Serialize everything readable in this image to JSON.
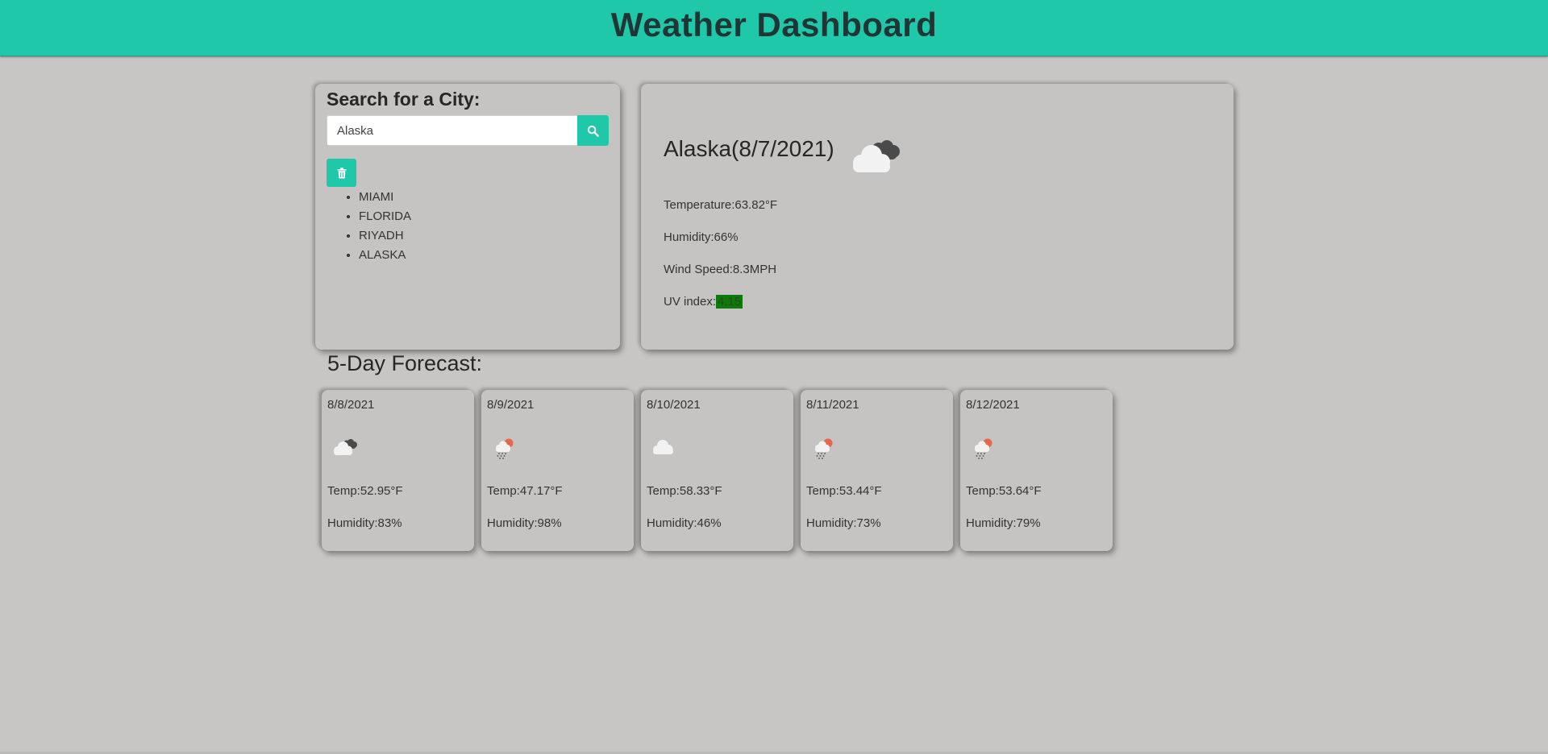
{
  "header": {
    "title": "Weather Dashboard"
  },
  "search": {
    "title": "Search for a City:",
    "input_value": "Alaska",
    "search_button_icon": "search-icon",
    "clear_button_icon": "trash-icon",
    "history": [
      "MIAMI",
      "FLORIDA",
      "RIYADH",
      "ALASKA"
    ]
  },
  "current": {
    "title": "Alaska(8/7/2021)",
    "icon": "broken-clouds-icon",
    "temperature": "Temperature:63.82°F",
    "humidity": "Humidity:66%",
    "wind": "Wind Speed:8.3MPH",
    "uv_label": "UV index:",
    "uv_value": "4.15"
  },
  "forecast": {
    "title": "5-Day Forecast:",
    "days": [
      {
        "date": "8/8/2021",
        "icon": "broken-clouds-icon",
        "temp": "Temp:52.95°F",
        "humidity": "Humidity:83%"
      },
      {
        "date": "8/9/2021",
        "icon": "rain-icon",
        "temp": "Temp:47.17°F",
        "humidity": "Humidity:98%"
      },
      {
        "date": "8/10/2021",
        "icon": "cloud-icon",
        "temp": "Temp:58.33°F",
        "humidity": "Humidity:46%"
      },
      {
        "date": "8/11/2021",
        "icon": "rain-icon",
        "temp": "Temp:53.44°F",
        "humidity": "Humidity:73%"
      },
      {
        "date": "8/12/2021",
        "icon": "rain-icon",
        "temp": "Temp:53.64°F",
        "humidity": "Humidity:79%"
      }
    ]
  },
  "colors": {
    "accent": "#1fc8a9",
    "background": "#c8c6c4",
    "uv_badge": "#0a7a0a"
  }
}
